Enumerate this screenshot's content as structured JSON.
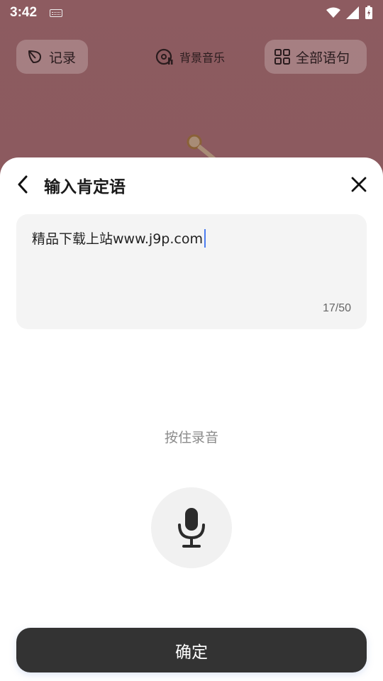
{
  "status_bar": {
    "time": "3:42"
  },
  "background": {
    "record_label": "记录",
    "music_label": "背景音乐",
    "all_phrases_label": "全部语句"
  },
  "sheet": {
    "title": "输入肯定语",
    "input_value": "精品下载上站www.j9p.com",
    "char_counter": "17/50",
    "hold_to_record": "按住录音",
    "confirm_label": "确定"
  },
  "colors": {
    "caret": "#4a7cf0",
    "confirm_bg": "#333333",
    "input_bg": "#f4f4f4"
  },
  "icons": [
    "keyboard-icon",
    "wifi-icon",
    "signal-icon",
    "battery-icon",
    "leaf-icon",
    "music-disc-icon",
    "grid-icon",
    "back-chevron-icon",
    "close-icon",
    "microphone-icon"
  ]
}
